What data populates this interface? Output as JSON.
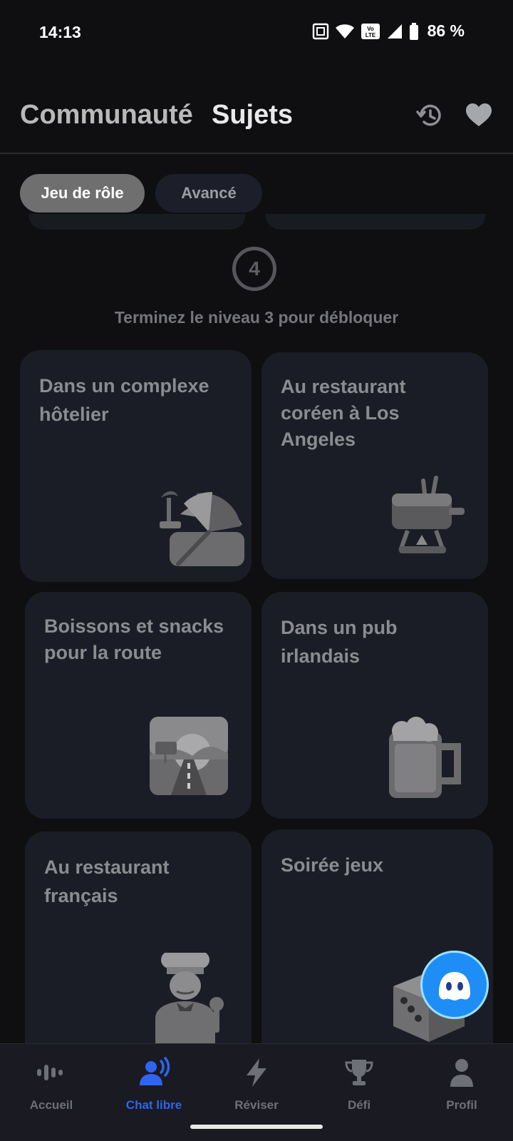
{
  "status_bar": {
    "time": "14:13",
    "battery_percent": "86 %",
    "icons": [
      "nfc-icon",
      "wifi-icon",
      "volte-icon",
      "cell-signal-icon",
      "battery-icon"
    ]
  },
  "header": {
    "tabs": [
      {
        "label": "Communauté",
        "active": false
      },
      {
        "label": "Sujets",
        "active": true
      }
    ],
    "icons": [
      "history-icon",
      "heart-icon"
    ]
  },
  "filters": {
    "chips": [
      {
        "label": "Jeu de rôle",
        "active": true
      },
      {
        "label": "Avancé",
        "active": false
      }
    ]
  },
  "level": {
    "number": "4",
    "lock_message": "Terminez le niveau 3 pour débloquer"
  },
  "cards": [
    {
      "title": "Dans un complexe hôtelier",
      "icon": "beach-umbrella-icon"
    },
    {
      "title": "Au restaurant coréen à Los Angeles",
      "icon": "fondue-pot-icon"
    },
    {
      "title": "Boissons et snacks pour la route",
      "icon": "road-trip-icon"
    },
    {
      "title": "Dans un pub irlandais",
      "icon": "beer-mug-icon"
    },
    {
      "title": "Au restaurant français",
      "icon": "chef-icon"
    },
    {
      "title": "Soirée jeux",
      "icon": "dice-icon"
    }
  ],
  "bottom_nav": {
    "items": [
      {
        "label": "Accueil",
        "icon": "voice-wave-icon",
        "active": false
      },
      {
        "label": "Chat libre",
        "icon": "speaking-person-icon",
        "active": true
      },
      {
        "label": "Réviser",
        "icon": "lightning-icon",
        "active": false
      },
      {
        "label": "Défi",
        "icon": "trophy-icon",
        "active": false
      },
      {
        "label": "Profil",
        "icon": "person-icon",
        "active": false
      }
    ]
  },
  "colors": {
    "background": "#0f0f11",
    "card": "#1b1d26",
    "accent": "#2f64f2",
    "chip_active": "#6f6f6f"
  }
}
